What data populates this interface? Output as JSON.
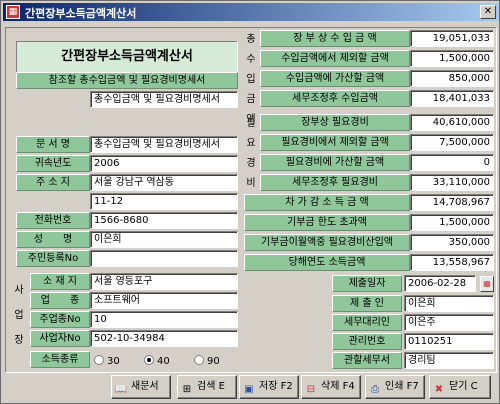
{
  "window": {
    "title": "간편장부소득금액계산서",
    "icon": "app-icon",
    "close_label": "✕"
  },
  "left": {
    "main_title": "간편장부소득금액계산서",
    "ref_label": "참조할 총수입금액 및 필요경비명세서",
    "ref_value": "총수입금액 및 필요경비명세서",
    "doc_name_label": "문 서 명",
    "doc_name_value": "총수입금액 및 필요경비명세서",
    "year_label": "귀속년도",
    "year_value": "2006",
    "address_label": "주 소 지",
    "address_value1": "서울 강남구 역삼동",
    "address_value2": "11-12",
    "phone_label": "전화번호",
    "phone_value": "1566-8680",
    "name_label": "성　　명",
    "name_value": "이은희",
    "rrn_label": "주민등록No",
    "rrn_value": "",
    "biz_group_label": "사업장",
    "biz_location_label": "소 재 지",
    "biz_location_value": "서울 영등포구",
    "biz_type_label": "업　　종",
    "biz_type_value": "소프트웨어",
    "biz_code_label": "주업종No",
    "biz_code_value": "10",
    "biz_reg_label": "사업자No",
    "biz_reg_value": "502-10-34984",
    "income_type_label": "소득종류",
    "income_options": [
      "30",
      "40",
      "90"
    ],
    "income_selected": "40"
  },
  "right": {
    "revenue_group_label": "총수입금액",
    "revenue_rows": [
      {
        "label": "장 부 상  수 입 금 액",
        "value": "19,051,033"
      },
      {
        "label": "수입금액에서 제외할 금액",
        "value": "1,500,000"
      },
      {
        "label": "수입금액에 가산할 금액",
        "value": "850,000"
      },
      {
        "label": "세무조정후 수입금액",
        "value": "18,401,033"
      }
    ],
    "expense_group_label": "필요경비",
    "expense_rows": [
      {
        "label": "장부상 필요경비",
        "value": "40,610,000"
      },
      {
        "label": "필요경비에서 제외할 금액",
        "value": "7,500,000"
      },
      {
        "label": "필요경비에 가산할 금액",
        "value": "0"
      },
      {
        "label": "세무조정후 필요경비",
        "value": "33,110,000"
      }
    ],
    "summary_rows": [
      {
        "label": "차 가 감  소 득  금 액",
        "value": "14,708,967"
      },
      {
        "label": "기부금  한도 초과액",
        "value": "1,500,000"
      },
      {
        "label": "기부금이월액중 필요경비산입액",
        "value": "350,000"
      },
      {
        "label": "당해연도 소득금액",
        "value": "13,558,967"
      }
    ],
    "submit_date_label": "제출일자",
    "submit_date_value": "2006-02-28",
    "submitter_label": "제 출 인",
    "submitter_value": "이은희",
    "agent_label": "세무대리인",
    "agent_value": "이은주",
    "manage_no_label": "관리번호",
    "manage_no_value": "0110251",
    "tax_office_label": "관할세무서",
    "tax_office_value": "경리팀"
  },
  "toolbar": {
    "new_label": "새문서",
    "search_label": "검색 E",
    "save_label": "저장 F2",
    "delete_label": "삭제 F4",
    "print_label": "인쇄 F7",
    "close_label": "닫기 C"
  },
  "colors": {
    "label_green": "#8fc79a",
    "title_blue": "#0a246a",
    "field_white": "#ffffff"
  }
}
